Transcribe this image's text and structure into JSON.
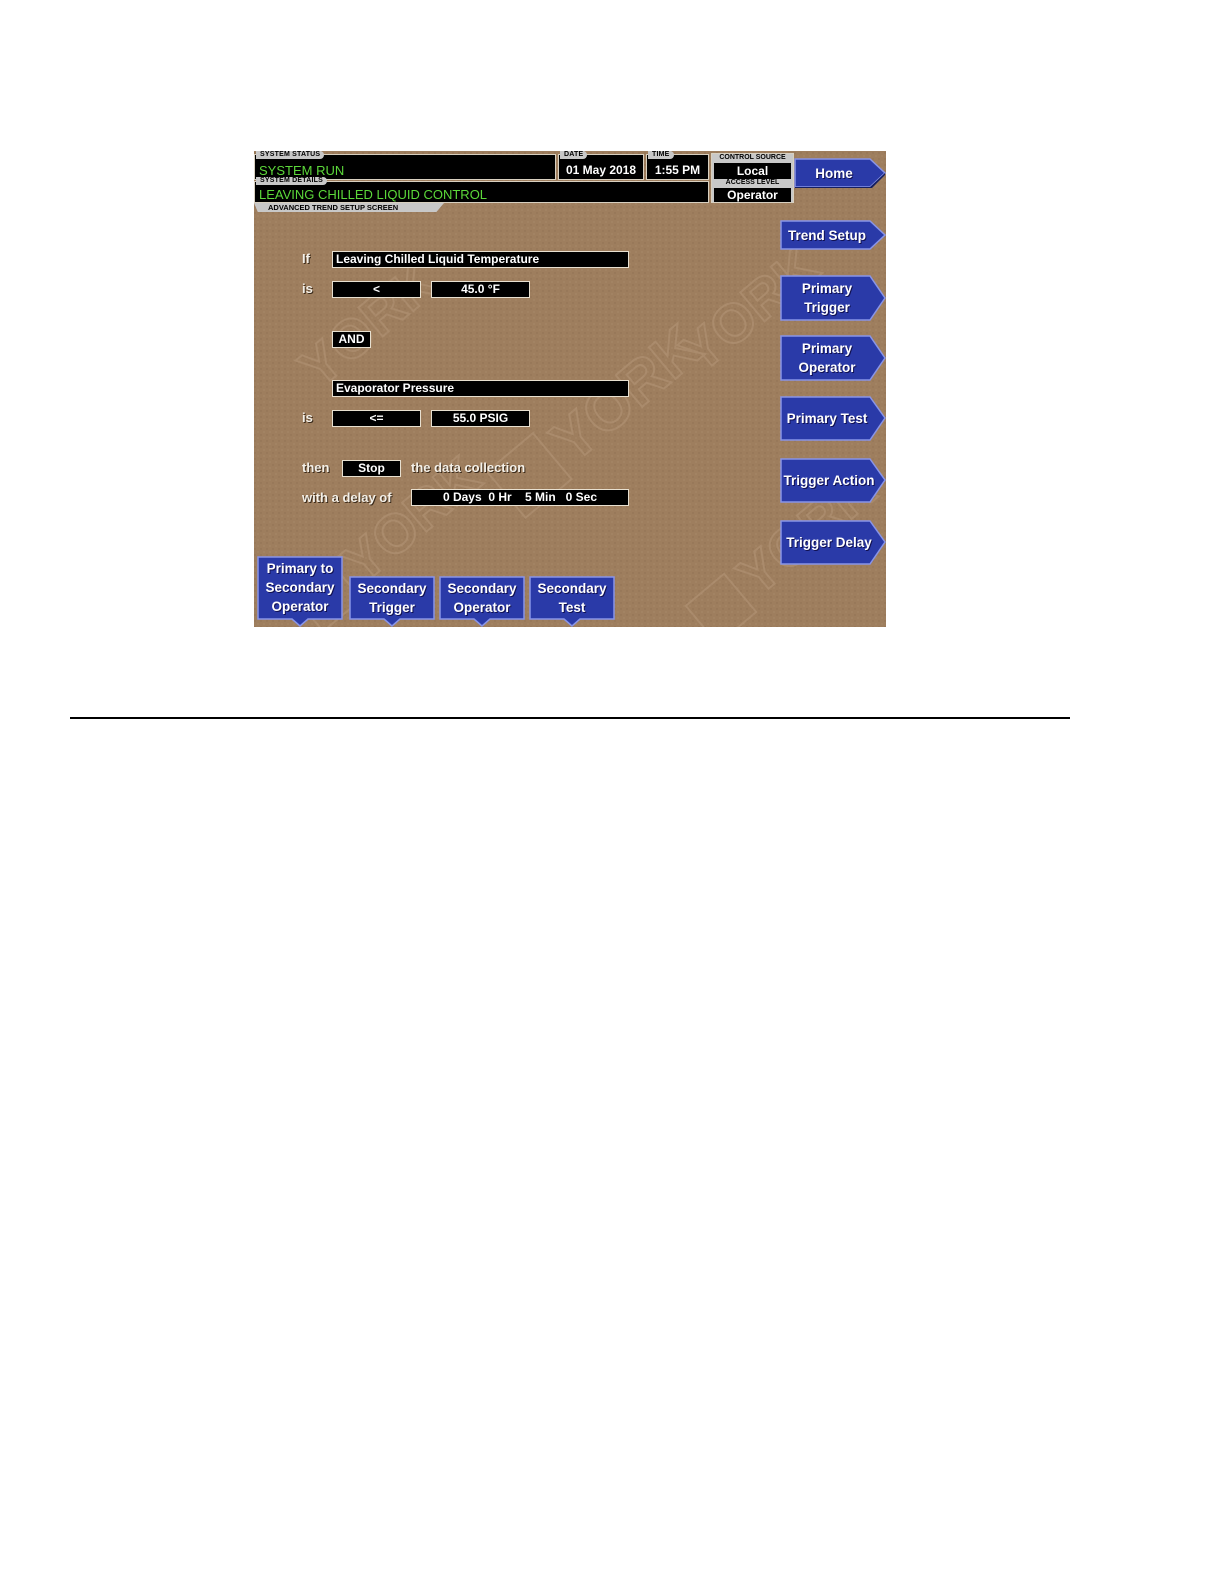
{
  "header": {
    "system_status_label": "SYSTEM STATUS",
    "system_status": "SYSTEM RUN",
    "system_details_label": "SYSTEM DETAILS",
    "system_details": "LEAVING CHILLED LIQUID CONTROL",
    "date_label": "DATE",
    "date": "01 May 2018",
    "time_label": "TIME",
    "time": "1:55 PM",
    "control_source_label": "CONTROL SOURCE",
    "control_source": "Local",
    "access_level_label": "ACCESS LEVEL",
    "access_level": "Operator",
    "screen_title": "ADVANCED TREND SETUP SCREEN"
  },
  "form": {
    "if_label": "If",
    "primary_trigger": "Leaving Chilled Liquid Temperature",
    "is_label_1": "is",
    "primary_operator": "<",
    "primary_test": "45.0 °F",
    "connector": "AND",
    "secondary_trigger": "Evaporator Pressure",
    "is_label_2": "is",
    "secondary_operator": "<=",
    "secondary_test": "55.0 PSIG",
    "then_label": "then",
    "action": "Stop",
    "action_suffix": "the data collection",
    "delay_label": "with a delay of",
    "delay": "0 Days  0 Hr    5 Min   0 Sec"
  },
  "right_buttons": {
    "home": "Home",
    "trend_setup": "Trend Setup",
    "primary_trigger": "Primary Trigger",
    "primary_operator": "Primary Operator",
    "primary_test": "Primary Test",
    "trigger_action": "Trigger Action",
    "trigger_delay": "Trigger Delay"
  },
  "bottom_buttons": {
    "primary_to_secondary_operator": "Primary to Secondary Operator",
    "secondary_trigger": "Secondary Trigger",
    "secondary_operator": "Secondary Operator",
    "secondary_test": "Secondary Test"
  },
  "colors": {
    "background": "#9e7e5e",
    "button_blue": "#2a3aa8",
    "status_green": "#5cd83a"
  }
}
